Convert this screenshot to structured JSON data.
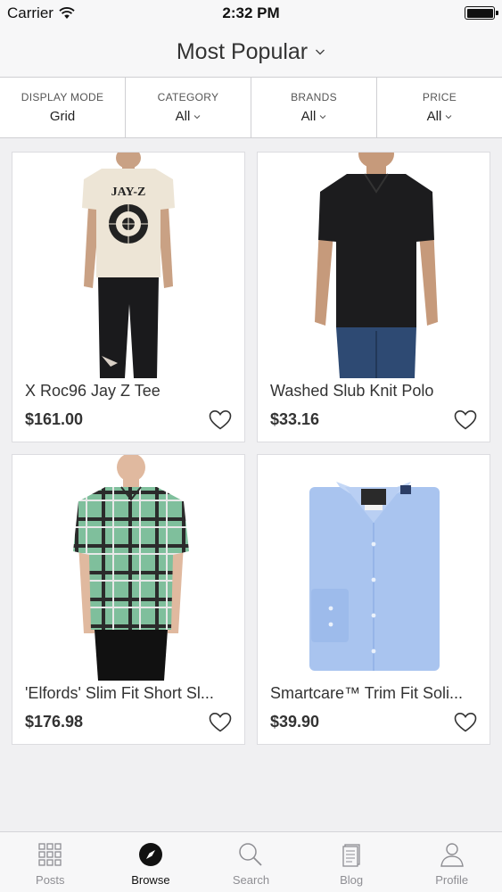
{
  "status_bar": {
    "carrier": "Carrier",
    "time": "2:32 PM"
  },
  "header": {
    "title": "Most Popular"
  },
  "filters": [
    {
      "label": "DISPLAY MODE",
      "value": "Grid"
    },
    {
      "label": "CATEGORY",
      "value": "All"
    },
    {
      "label": "BRANDS",
      "value": "All"
    },
    {
      "label": "PRICE",
      "value": "All"
    }
  ],
  "products": [
    {
      "name": "X Roc96 Jay Z Tee",
      "price": "$161.00",
      "image_label": "JAY-Z"
    },
    {
      "name": "Washed Slub Knit Polo",
      "price": "$33.16"
    },
    {
      "name": "'Elfords' Slim Fit Short Sl...",
      "price": "$176.98"
    },
    {
      "name": "Smartcare™ Trim Fit Soli...",
      "price": "$39.90"
    }
  ],
  "tabs": [
    {
      "label": "Posts",
      "icon": "grid-icon"
    },
    {
      "label": "Browse",
      "icon": "compass-icon"
    },
    {
      "label": "Search",
      "icon": "magnifier-icon"
    },
    {
      "label": "Blog",
      "icon": "document-icon"
    },
    {
      "label": "Profile",
      "icon": "person-icon"
    }
  ],
  "active_tab": "Browse",
  "colors": {
    "background": "#f0f0f2",
    "bar": "#f7f7f8",
    "text": "#333333",
    "inactive_tab": "#8e8e93"
  }
}
